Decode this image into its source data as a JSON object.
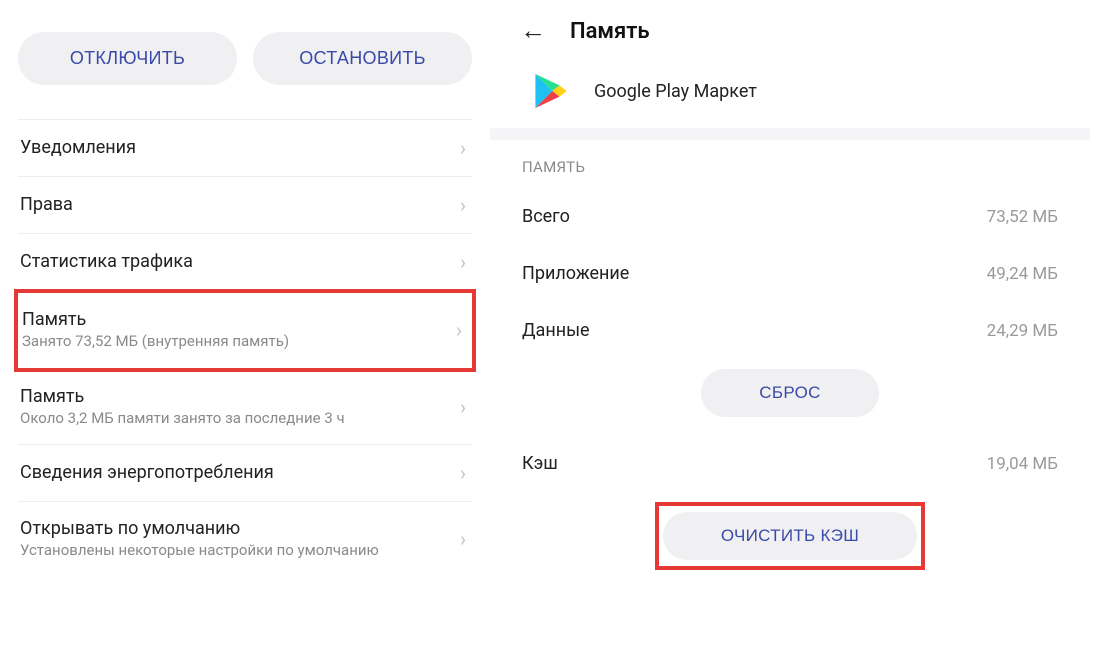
{
  "left": {
    "buttons": {
      "disable": "ОТКЛЮЧИТЬ",
      "stop": "ОСТАНОВИТЬ"
    },
    "items": [
      {
        "title": "Уведомления",
        "subtitle": ""
      },
      {
        "title": "Права",
        "subtitle": ""
      },
      {
        "title": "Статистика трафика",
        "subtitle": ""
      },
      {
        "title": "Память",
        "subtitle": "Занято 73,52 МБ (внутренняя память)",
        "highlighted": true
      },
      {
        "title": "Память",
        "subtitle": "Около 3,2 МБ памяти занято за последние 3 ч"
      },
      {
        "title": "Сведения энергопотребления",
        "subtitle": ""
      },
      {
        "title": "Открывать по умолчанию",
        "subtitle": "Установлены некоторые настройки по умолчанию"
      }
    ]
  },
  "right": {
    "header": "Память",
    "app_name": "Google Play Маркет",
    "section_label": "ПАМЯТЬ",
    "rows": {
      "total": {
        "label": "Всего",
        "value": "73,52 МБ"
      },
      "app": {
        "label": "Приложение",
        "value": "49,24 МБ"
      },
      "data": {
        "label": "Данные",
        "value": "24,29 МБ"
      },
      "cache": {
        "label": "Кэш",
        "value": "19,04 МБ"
      }
    },
    "buttons": {
      "reset": "СБРОС",
      "clear_cache": "ОЧИСТИТЬ КЭШ"
    }
  }
}
